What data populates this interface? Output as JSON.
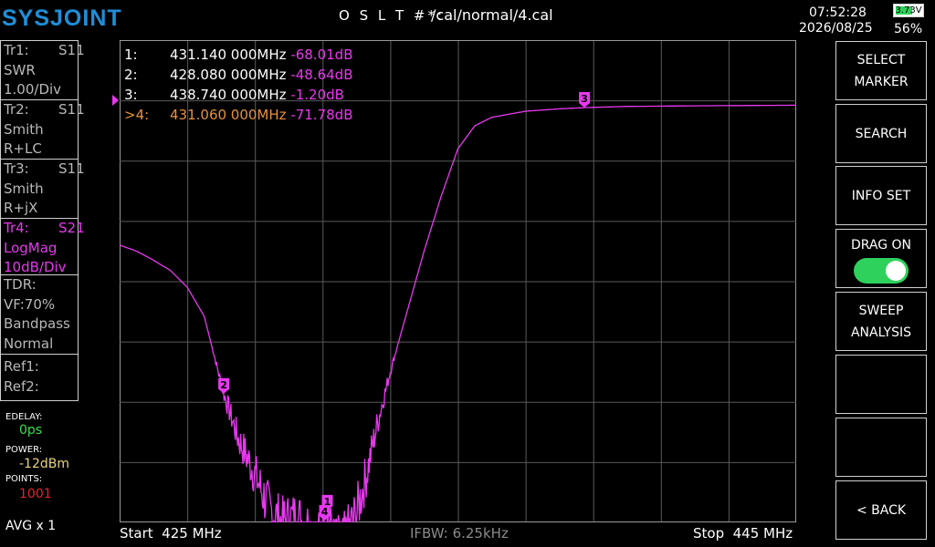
{
  "header": {
    "logo": "SYSJOINT",
    "cal_prefix": "O S L T #*:",
    "cal_path": "/cal/normal/4.cal",
    "time": "07:52:28",
    "date": "2026/08/25",
    "battery_voltage": "3.73V",
    "battery_percent": "56%"
  },
  "traces": [
    {
      "name": "Tr1:",
      "param": "S11",
      "format": "SWR",
      "scale": "1.00/Div",
      "active": false
    },
    {
      "name": "Tr2:",
      "param": "S11",
      "format": "Smith",
      "scale": "R+LC",
      "active": false
    },
    {
      "name": "Tr3:",
      "param": "S11",
      "format": "Smith",
      "scale": "R+jX",
      "active": false
    },
    {
      "name": "Tr4:",
      "param": "S21",
      "format": "LogMag",
      "scale": "10dB/Div",
      "active": true
    }
  ],
  "tdr": {
    "label": "TDR:",
    "vf": "VF:70%",
    "mode": "Bandpass",
    "window": "Normal"
  },
  "refs": {
    "ref1": "Ref1:",
    "ref2": "Ref2:"
  },
  "settings": {
    "edelay_label": "EDELAY:",
    "edelay_value": "0ps",
    "power_label": "POWER:",
    "power_value": "-12dBm",
    "points_label": "POINTS:",
    "points_value": "1001",
    "avg": "AVG x 1"
  },
  "markers": [
    {
      "num": "1:",
      "freq": "431.140 000MHz",
      "value": "-68.01dB",
      "active": false
    },
    {
      "num": "2:",
      "freq": "428.080 000MHz",
      "value": "-48.64dB",
      "active": false
    },
    {
      "num": "3:",
      "freq": "438.740 000MHz",
      "value": "-1.20dB",
      "active": false
    },
    {
      "num": ">4:",
      "freq": "431.060 000MHz",
      "value": "-71.78dB",
      "active": true
    }
  ],
  "footer": {
    "start": "Start  425 MHz",
    "ifbw": "IFBW: 6.25kHz",
    "stop": "Stop  445 MHz"
  },
  "buttons": {
    "select_marker": "SELECT\nMARKER",
    "search": "SEARCH",
    "info_set": "INFO SET",
    "drag_on": "DRAG ON",
    "sweep_analysis": "SWEEP\nANALYSIS",
    "back": "< BACK"
  },
  "drag_toggle_on": true,
  "colors": {
    "trace": "#e838ef",
    "grid": "#5a5a5a",
    "marker_active": "#e8913a",
    "edelay": "#35e04a",
    "power": "#e8d57a",
    "points": "#e8222a",
    "logo": "#1e8fd8",
    "toggle": "#2ed15c"
  },
  "chart_data": {
    "type": "line",
    "x_range_mhz": [
      425,
      445
    ],
    "y_divisions": 8,
    "scale_db_per_div": 10,
    "series": [
      {
        "points": [
          [
            425.0,
            -24.0
          ],
          [
            425.5,
            -25.0
          ],
          [
            426.0,
            -26.5
          ],
          [
            426.5,
            -28.2
          ],
          [
            427.0,
            -31.0
          ],
          [
            427.5,
            -35.8
          ],
          [
            428.08,
            -48.64
          ],
          [
            428.5,
            -56.0
          ],
          [
            429.0,
            -62.0
          ],
          [
            429.4,
            -67.5
          ],
          [
            429.8,
            -70.0
          ],
          [
            430.2,
            -69.0
          ],
          [
            430.6,
            -70.5
          ],
          [
            430.8,
            -72.5
          ],
          [
            431.06,
            -71.78
          ],
          [
            431.14,
            -68.01
          ],
          [
            431.3,
            -73.0
          ],
          [
            431.6,
            -73.0
          ],
          [
            432.0,
            -68.5
          ],
          [
            432.3,
            -62.0
          ],
          [
            432.6,
            -54.0
          ],
          [
            433.0,
            -45.0
          ],
          [
            433.5,
            -35.0
          ],
          [
            434.0,
            -25.0
          ],
          [
            434.5,
            -16.0
          ],
          [
            435.0,
            -8.0
          ],
          [
            435.5,
            -4.2
          ],
          [
            436.0,
            -2.8
          ],
          [
            437.0,
            -1.8
          ],
          [
            438.0,
            -1.4
          ],
          [
            438.74,
            -1.2
          ],
          [
            440.0,
            -1.0
          ],
          [
            442.0,
            -0.9
          ],
          [
            445.0,
            -0.8
          ]
        ]
      }
    ],
    "marker_labels": [
      {
        "id": "1",
        "x": 431.14,
        "y": -68.01
      },
      {
        "id": "2",
        "x": 428.08,
        "y": -48.64
      },
      {
        "id": "3",
        "x": 438.74,
        "y": -1.2
      },
      {
        "id": "4",
        "x": 431.06,
        "y": -71.78
      }
    ]
  }
}
